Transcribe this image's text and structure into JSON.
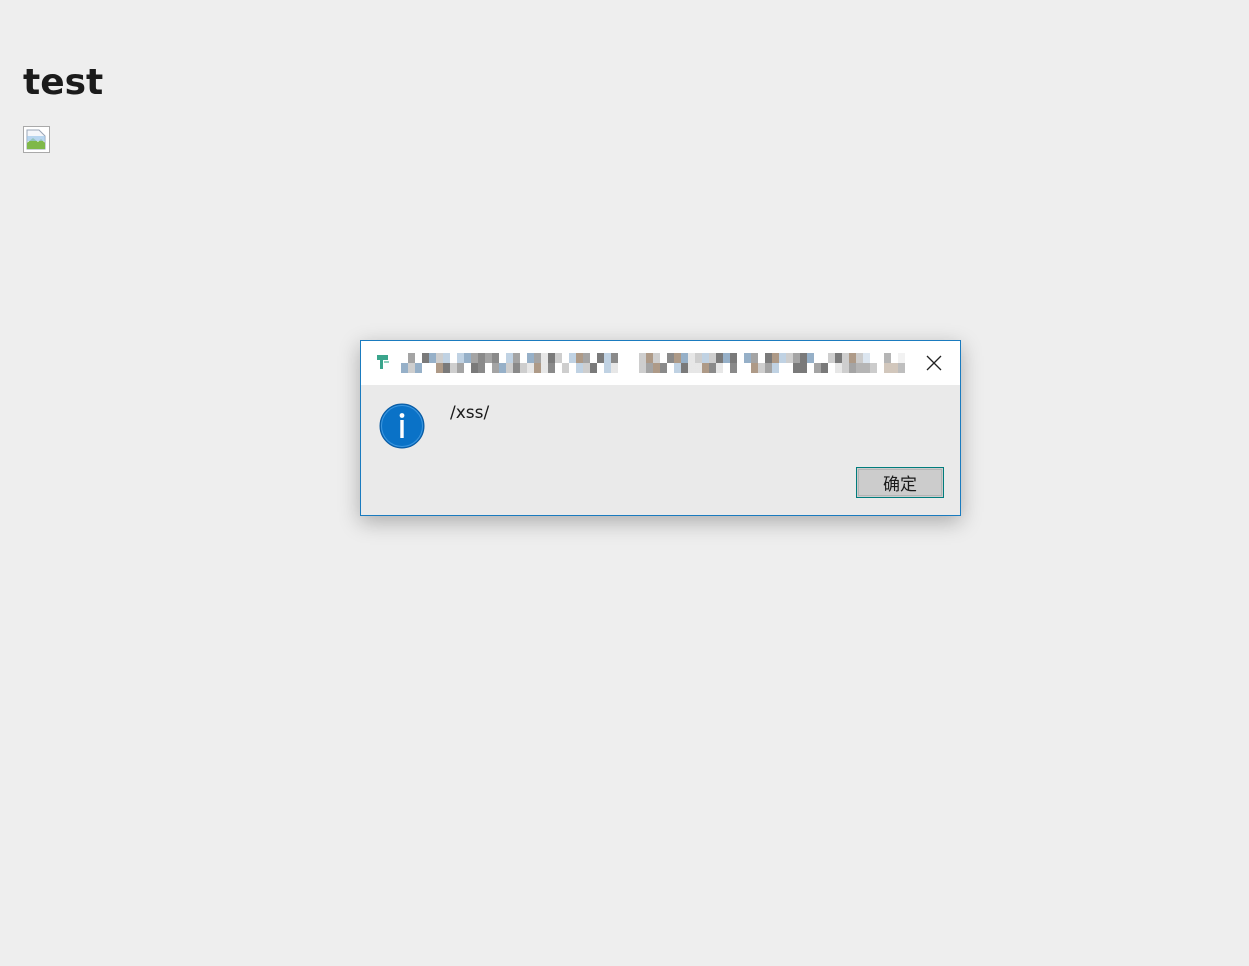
{
  "page": {
    "heading": "test",
    "image_alt": "broken-image"
  },
  "dialog": {
    "title": "",
    "message": "/xss/",
    "ok_label": "确定",
    "close_icon": "close-icon",
    "info_icon": "info-icon",
    "accent_color": "#0a72c7"
  }
}
